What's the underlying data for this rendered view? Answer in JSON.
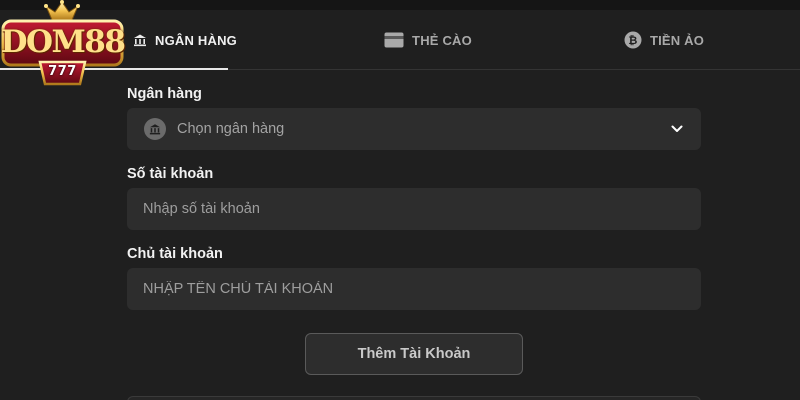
{
  "logo": {
    "text": "DOM88",
    "badge": "777"
  },
  "tabs": [
    {
      "label": "NGÂN HÀNG",
      "icon": "bank-icon",
      "active": true
    },
    {
      "label": "THẺ CÀO",
      "icon": "card-icon",
      "active": false
    },
    {
      "label": "TIỀN ẢO",
      "icon": "bitcoin-icon",
      "active": false
    }
  ],
  "form": {
    "bank_label": "Ngân hàng",
    "bank_placeholder": "Chọn ngân hàng",
    "account_number_label": "Số tài khoản",
    "account_number_placeholder": "Nhập số tài khoản",
    "account_holder_label": "Chủ tài khoản",
    "account_holder_placeholder": "NHẬP TÊN CHỦ TÀI KHOẢN",
    "submit_label": "Thêm Tài Khoản"
  },
  "colors": {
    "background": "#1f1f1f",
    "field": "#2d2d2d",
    "logo_red": "#8b0f1e",
    "logo_gold": "#f2c14e"
  }
}
